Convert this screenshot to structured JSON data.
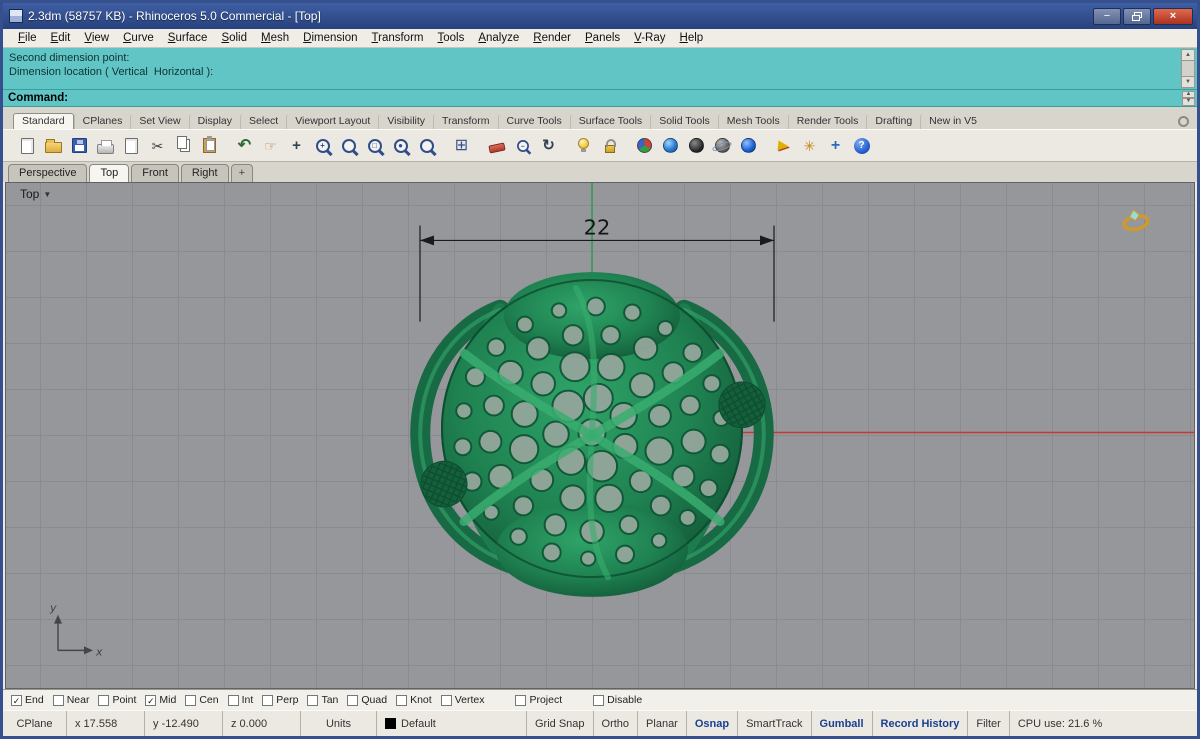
{
  "window": {
    "title": "2.3dm (58757 KB) - Rhinoceros 5.0 Commercial - [Top]"
  },
  "ui": {
    "scroll_up": "▲",
    "scroll_down": "▼",
    "spin_up": "▲",
    "spin_down": "▼",
    "dropdown_arrow": "▼",
    "check_glyph": "✓",
    "new_viewport_tab": "+",
    "window_minimize": "−",
    "window_close": "×"
  },
  "menu": {
    "items": [
      "File",
      "Edit",
      "View",
      "Curve",
      "Surface",
      "Solid",
      "Mesh",
      "Dimension",
      "Transform",
      "Tools",
      "Analyze",
      "Render",
      "Panels",
      "V-Ray",
      "Help"
    ]
  },
  "command": {
    "history_lines": [
      "Second dimension point:",
      "Dimension location ( Vertical  Horizontal ):"
    ],
    "prompt_label": "Command:",
    "input_value": ""
  },
  "toolbar_tabs": {
    "active": "Standard",
    "items": [
      "Standard",
      "CPlanes",
      "Set View",
      "Display",
      "Select",
      "Viewport Layout",
      "Visibility",
      "Transform",
      "Curve Tools",
      "Surface Tools",
      "Solid Tools",
      "Mesh Tools",
      "Render Tools",
      "Drafting",
      "New in V5"
    ]
  },
  "toolbar_icons": [
    {
      "name": "new-file",
      "glyph": ""
    },
    {
      "name": "open-folder",
      "glyph": ""
    },
    {
      "name": "save",
      "glyph": ""
    },
    {
      "name": "print",
      "glyph": ""
    },
    {
      "name": "export-file",
      "glyph": ""
    },
    {
      "name": "cut",
      "glyph": "✂"
    },
    {
      "name": "copy",
      "glyph": ""
    },
    {
      "name": "paste",
      "glyph": ""
    },
    {
      "name": "undo",
      "glyph": "↶"
    },
    {
      "name": "pan-hand",
      "glyph": "☞"
    },
    {
      "name": "move",
      "glyph": "+"
    },
    {
      "name": "zoom-in",
      "glyph": "+"
    },
    {
      "name": "zoom-dynamic",
      "glyph": ""
    },
    {
      "name": "zoom-window",
      "glyph": "□"
    },
    {
      "name": "zoom-selected",
      "glyph": "●"
    },
    {
      "name": "zoom-extents",
      "glyph": ""
    },
    {
      "name": "viewport-layout-grid",
      "glyph": "⊞"
    },
    {
      "name": "eraser",
      "glyph": ""
    },
    {
      "name": "zoom-lens-pair",
      "glyph": "−"
    },
    {
      "name": "rotate-view",
      "glyph": "↻"
    },
    {
      "name": "lamp",
      "glyph": ""
    },
    {
      "name": "lock",
      "glyph": ""
    },
    {
      "name": "render",
      "glyph": ""
    },
    {
      "name": "render-preview-globe",
      "glyph": ""
    },
    {
      "name": "render-sphere-dark",
      "glyph": ""
    },
    {
      "name": "render-sphere-ringed",
      "glyph": ""
    },
    {
      "name": "render-sphere-blue",
      "glyph": ""
    },
    {
      "name": "notification-flag",
      "glyph": ""
    },
    {
      "name": "options-gears",
      "glyph": "✳"
    },
    {
      "name": "gumball-widget",
      "glyph": "+"
    },
    {
      "name": "help",
      "glyph": "?"
    }
  ],
  "viewport_tabs": {
    "active": "Top",
    "items": [
      "Perspective",
      "Top",
      "Front",
      "Right"
    ]
  },
  "viewport": {
    "view_label": "Top",
    "dimension_label": "22",
    "axis_x": "x",
    "axis_y": "y"
  },
  "osnap": {
    "items": [
      {
        "label": "End",
        "checked": true
      },
      {
        "label": "Near",
        "checked": false
      },
      {
        "label": "Point",
        "checked": false
      },
      {
        "label": "Mid",
        "checked": true
      },
      {
        "label": "Cen",
        "checked": false
      },
      {
        "label": "Int",
        "checked": false
      },
      {
        "label": "Perp",
        "checked": false
      },
      {
        "label": "Tan",
        "checked": false
      },
      {
        "label": "Quad",
        "checked": false
      },
      {
        "label": "Knot",
        "checked": false
      },
      {
        "label": "Vertex",
        "checked": false
      },
      {
        "label": "Project",
        "checked": false
      },
      {
        "label": "Disable",
        "checked": false
      }
    ]
  },
  "status": {
    "cells": [
      "CPlane",
      "x 17.558",
      "y -12.490",
      "z 0.000",
      "Units",
      "Default",
      "Grid Snap",
      "Ortho",
      "Planar",
      "Osnap",
      "SmartTrack",
      "Gumball",
      "Record History",
      "Filter",
      "CPU use: 21.6 %"
    ]
  }
}
